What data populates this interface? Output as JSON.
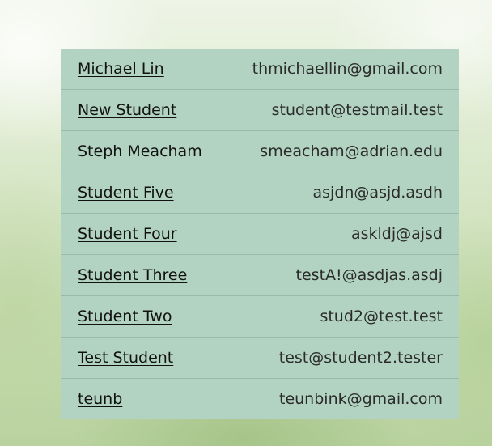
{
  "students": [
    {
      "name": "Michael Lin",
      "email": "thmichaellin@gmail.com"
    },
    {
      "name": "New Student",
      "email": "student@testmail.test"
    },
    {
      "name": "Steph Meacham",
      "email": "smeacham@adrian.edu"
    },
    {
      "name": "Student Five",
      "email": "asjdn@asjd.asdh"
    },
    {
      "name": "Student Four",
      "email": "askldj@ajsd"
    },
    {
      "name": "Student Three",
      "email": "testA!@asdjas.asdj"
    },
    {
      "name": "Student Two",
      "email": "stud2@test.test"
    },
    {
      "name": "Test Student",
      "email": "test@student2.tester"
    },
    {
      "name": "teunb",
      "email": "teunbink@gmail.com"
    }
  ],
  "colors": {
    "panel_background": "#b2d3c2",
    "row_divider": "#98bca9",
    "page_background": "#cfe1bb"
  }
}
